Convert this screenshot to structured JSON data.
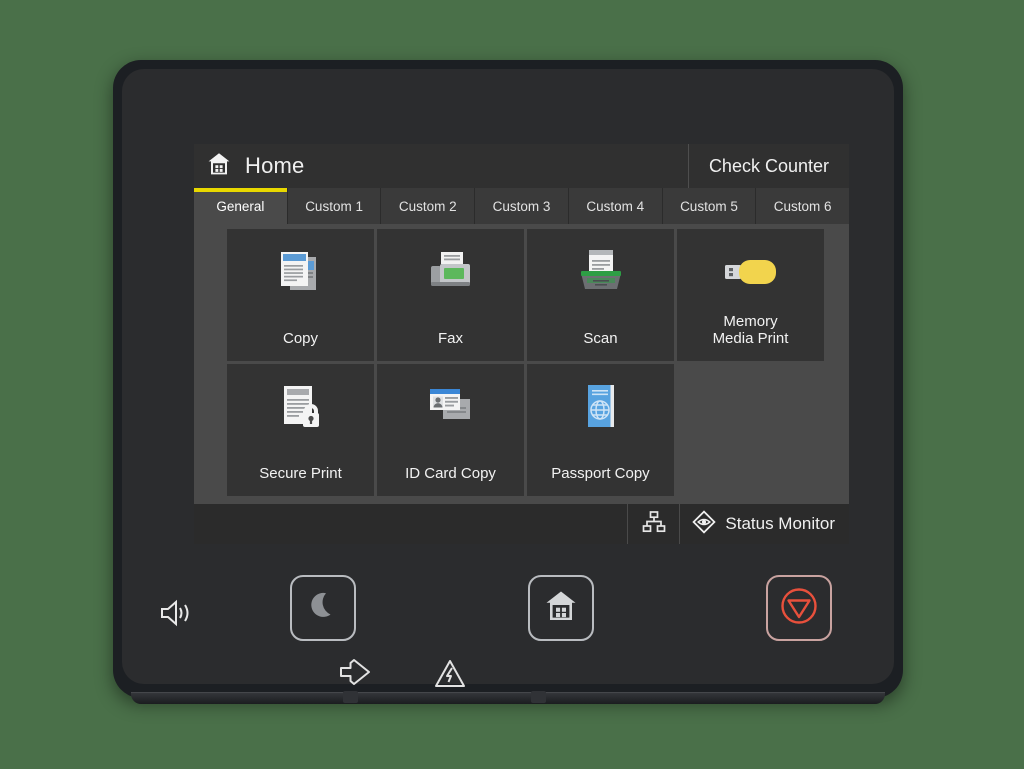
{
  "background_color": "#4a7049",
  "device": {
    "name": "multifunction-printer-control-panel",
    "bezel_color": "#1c1f23",
    "body_color": "#2b2c2e"
  },
  "screen": {
    "background_color": "#2b2b2b",
    "header": {
      "home_icon": "home-house-grid-icon",
      "title": "Home",
      "check_counter_label": "Check Counter"
    },
    "tabs": {
      "active_indicator_color": "#e8d800",
      "items": [
        {
          "label": "General",
          "active": true
        },
        {
          "label": "Custom 1",
          "active": false
        },
        {
          "label": "Custom 2",
          "active": false
        },
        {
          "label": "Custom 3",
          "active": false
        },
        {
          "label": "Custom 4",
          "active": false
        },
        {
          "label": "Custom 5",
          "active": false
        },
        {
          "label": "Custom 6",
          "active": false
        }
      ]
    },
    "panel": {
      "background_color": "#4a4a4a",
      "tile_color": "#333333",
      "rows": [
        [
          {
            "label": "Copy",
            "icon": "copy-documents-icon",
            "accent": "#5b9bd5"
          },
          {
            "label": "Fax",
            "icon": "fax-machine-icon",
            "accent": "#5cb85c"
          },
          {
            "label": "Scan",
            "icon": "scanner-icon",
            "accent": "#2e9e45"
          },
          {
            "label": "Memory\nMedia Print",
            "icon": "usb-flash-drive-icon",
            "accent": "#f2d44d"
          }
        ],
        [
          {
            "label": "Secure Print",
            "icon": "document-lock-icon",
            "accent": "#d8d8d8"
          },
          {
            "label": "ID Card Copy",
            "icon": "id-card-icon",
            "accent": "#3b87d6"
          },
          {
            "label": "Passport Copy",
            "icon": "passport-book-icon",
            "accent": "#58a3e0"
          },
          {
            "label": "",
            "icon": "",
            "accent": "",
            "empty": true
          }
        ]
      ]
    },
    "status_bar": {
      "network_icon": "network-lan-icon",
      "status_monitor_icon": "status-monitor-eye-diamond-icon",
      "status_monitor_label": "Status Monitor"
    }
  },
  "hardware": {
    "speaker_icon": "speaker-volume-icon",
    "buttons": [
      {
        "name": "sleep-button",
        "icon": "crescent-moon-icon",
        "color": "#8d9094"
      },
      {
        "name": "home-button",
        "icon": "home-house-grid-icon",
        "color": "#d4d6d8"
      },
      {
        "name": "stop-button",
        "icon": "stop-circle-triangle-icon",
        "color": "#e8503c"
      }
    ],
    "indicators": [
      {
        "name": "data-indicator",
        "icon": "arrow-into-diamond-icon"
      },
      {
        "name": "error-indicator",
        "icon": "warning-triangle-lightning-icon"
      }
    ]
  }
}
